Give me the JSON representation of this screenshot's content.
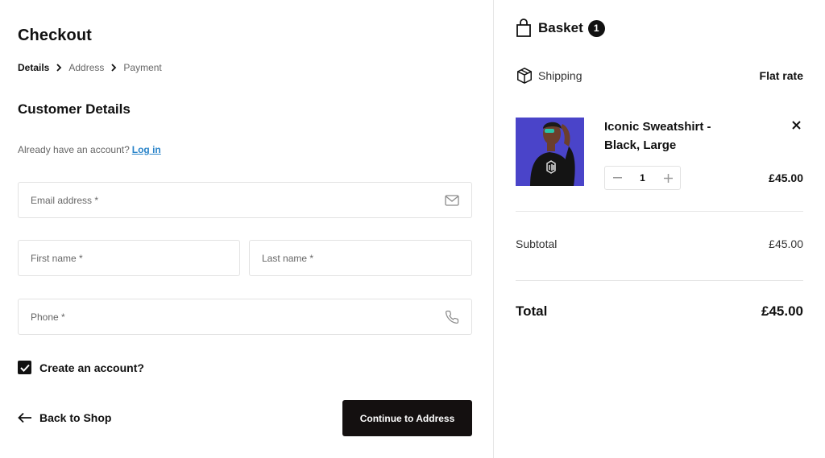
{
  "checkout": {
    "title": "Checkout",
    "breadcrumb": [
      "Details",
      "Address",
      "Payment"
    ],
    "section_title": "Customer Details",
    "account_prompt": "Already have an account?",
    "login_link": "Log in",
    "fields": {
      "email_placeholder": "Email address *",
      "first_name_placeholder": "First name *",
      "last_name_placeholder": "Last name *",
      "phone_placeholder": "Phone *"
    },
    "create_account_label": "Create an account?",
    "create_account_checked": true,
    "back_label": "Back to Shop",
    "continue_label": "Continue to Address"
  },
  "basket": {
    "title": "Basket",
    "count": "1",
    "shipping_label": "Shipping",
    "shipping_value": "Flat rate",
    "item": {
      "name": "Iconic Sweatshirt - Black, Large",
      "quantity": "1",
      "price": "£45.00"
    },
    "subtotal_label": "Subtotal",
    "subtotal_value": "£45.00",
    "total_label": "Total",
    "total_value": "£45.00"
  },
  "colors": {
    "accent_link": "#2a84c9",
    "primary_button": "#141010",
    "product_background": "#4a44c9"
  },
  "icons": [
    "chevron-right-icon",
    "mail-icon",
    "phone-icon",
    "checkmark-icon",
    "arrow-left-icon",
    "shopping-bag-icon",
    "package-box-icon",
    "close-icon",
    "minus-icon",
    "plus-icon"
  ]
}
